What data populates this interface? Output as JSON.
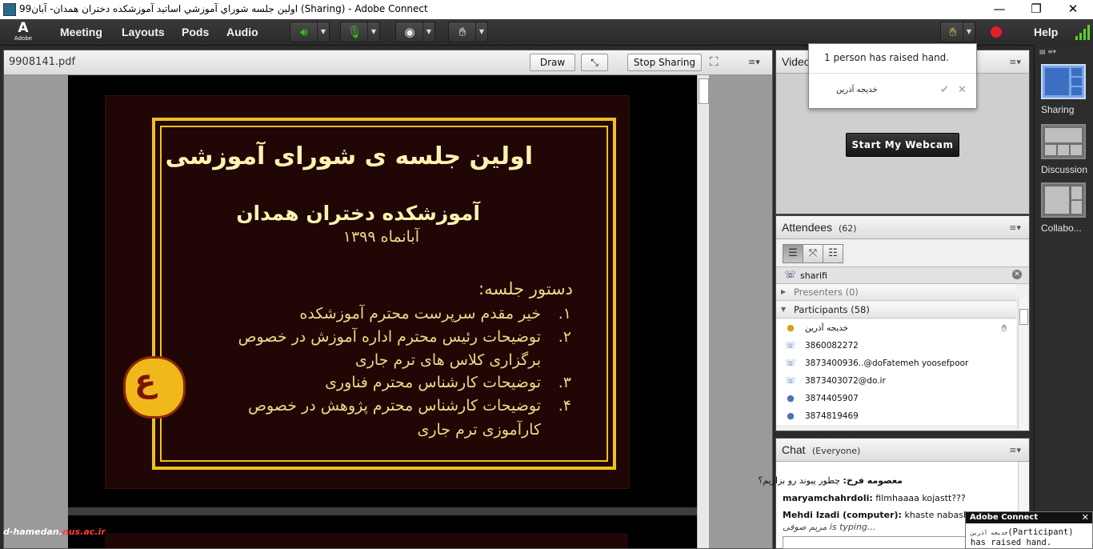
{
  "window": {
    "title": "اولین جلسه شوراي آموزشي اساتيد آموزشكده دختران همدان- آبان99 (Sharing) - Adobe Connect",
    "controls": {
      "minimize": "—",
      "maximize": "❐",
      "close": "✕"
    }
  },
  "menubar": {
    "logo": "Adobe",
    "items": [
      "Meeting",
      "Layouts",
      "Pods",
      "Audio"
    ],
    "help": "Help",
    "tool_icons": [
      "speaker-icon",
      "microphone-icon",
      "webcam-icon",
      "raise-hand-icon"
    ]
  },
  "share_pod": {
    "filename": "9908141.pdf",
    "draw_label": "Draw",
    "stop_sharing_label": "Stop Sharing",
    "menu_glyph": "≡▾"
  },
  "slide": {
    "title": "اولین جلسه ی شورای آموزشی",
    "school": "آموزشکده دختران همدان",
    "date": "آبانماه ۱۳۹۹",
    "agenda_heading": "دستور جلسه:",
    "items": [
      "خیر مقدم سرپرست محترم آموزشکده",
      "توضیحات رئیس محترم اداره آموزش در خصوص",
      "برگزاری کلاس های ترم جاری",
      "توضیحات کارشناس محترم فناوری",
      "توضیحات کارشناس محترم پژوهش در خصوص",
      "کارآموزی ترم جاری"
    ],
    "numbers": [
      "۱.",
      "۲.",
      "۳.",
      "۴."
    ]
  },
  "watermark": {
    "prefix": "d-hamedan.",
    "suffix": "nus.ac.ir"
  },
  "video_pod": {
    "title": "Video",
    "start_webcam": "Start My Webcam"
  },
  "raise_hand_popup": {
    "message": "1 person has raised hand.",
    "person": "خدیجه آذرین",
    "accept": "✔",
    "dismiss": "✕"
  },
  "attendees_pod": {
    "title": "Attendees",
    "count": "(62)",
    "filter_text": "sharifi",
    "groups": {
      "presenters": "Presenters (0)",
      "participants": "Participants (58)"
    },
    "rows": [
      {
        "name": "خدیجه آذرین",
        "icon": "person-icon",
        "color": "#d6a21c"
      },
      {
        "name": "3860082272",
        "icon": "phone-person-icon",
        "color": "#4d74b8"
      },
      {
        "name": "3873400936..@doFatemeh yoosefpoor",
        "icon": "phone-person-icon",
        "color": "#4d74b8"
      },
      {
        "name": "3873403072@do.ir",
        "icon": "phone-person-icon",
        "color": "#4d74b8"
      },
      {
        "name": "3874405907",
        "icon": "person-icon",
        "color": "#4d74b8"
      },
      {
        "name": "3874819469",
        "icon": "person-icon",
        "color": "#4d74b8"
      }
    ]
  },
  "chat_pod": {
    "title": "Chat",
    "audience": "(Everyone)",
    "messages": [
      {
        "sender": "معصومه فرخ:",
        "text": "چطور پیوند رو بزاریم؟"
      },
      {
        "sender": "maryamchahrdoli:",
        "text": " filmhaaaa kojastt???"
      },
      {
        "sender": "Mehdi Izadi (computer):",
        "text": " khaste nabashid"
      }
    ],
    "typing_name": "مریم صوفی",
    "typing_suffix": " is typing..."
  },
  "layouts": [
    {
      "label": "Sharing",
      "selected": true
    },
    {
      "label": "Discussion",
      "selected": false
    },
    {
      "label": "Collabo...",
      "selected": false
    }
  ],
  "toast": {
    "title": "Adobe Connect",
    "close": "✕",
    "name": "خدیجه آذرین",
    "message": "(Participant) has raised hand."
  },
  "colors": {
    "accent_gold": "#f2c01f",
    "slide_bg": "#200604",
    "record_red": "#e3202a"
  }
}
